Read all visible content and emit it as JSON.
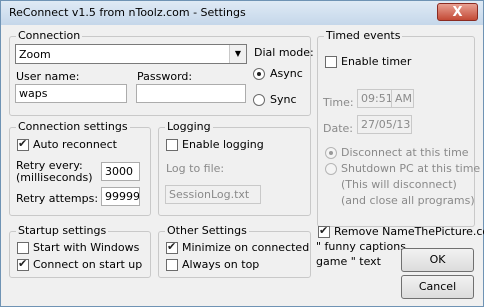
{
  "window": {
    "title": "ReConnect v1.5 from nToolz.com - Settings",
    "close_label": "X"
  },
  "connection": {
    "legend": "Connection",
    "selected_option": "Zoom",
    "dial_mode_label": "Dial mode:",
    "async_label": "Async",
    "sync_label": "Sync",
    "username_label": "User name:",
    "username_value": "waps",
    "password_label": "Password:",
    "password_value": ""
  },
  "timed_events": {
    "legend": "Timed events",
    "enable_timer_label": "Enable timer",
    "time_label": "Time:",
    "time_value": "09:51",
    "ampm_value": "AM",
    "date_label": "Date:",
    "date_value": "27/05/13",
    "disconnect_label": "Disconnect at this time",
    "shutdown_label": "Shutdown PC at this time",
    "shutdown_note1": "(This will disconnect)",
    "shutdown_note2": "(and close all programs)"
  },
  "connection_settings": {
    "legend": "Connection settings",
    "auto_reconnect_label": "Auto reconnect",
    "retry_every_label1": "Retry every:",
    "retry_every_label2": "(milliseconds)",
    "retry_every_value": "3000",
    "retry_attempts_label": "Retry attemps:",
    "retry_attempts_value": "99999"
  },
  "logging": {
    "legend": "Logging",
    "enable_logging_label": "Enable logging",
    "log_to_file_label": "Log to file:",
    "log_file_value": "SessionLog.txt"
  },
  "startup_settings": {
    "legend": "Startup settings",
    "start_with_windows_label": "Start with Windows",
    "connect_on_startup_label": "Connect on start up"
  },
  "other_settings": {
    "legend": "Other Settings",
    "minimize_label": "Minimize on connected",
    "always_on_top_label": "Always on top"
  },
  "remove_promo": {
    "label": "Remove NameThePicture.com",
    "line2": "\" funny captions",
    "line3": "game \" text"
  },
  "buttons": {
    "ok_label": "OK",
    "cancel_label": "Cancel"
  }
}
